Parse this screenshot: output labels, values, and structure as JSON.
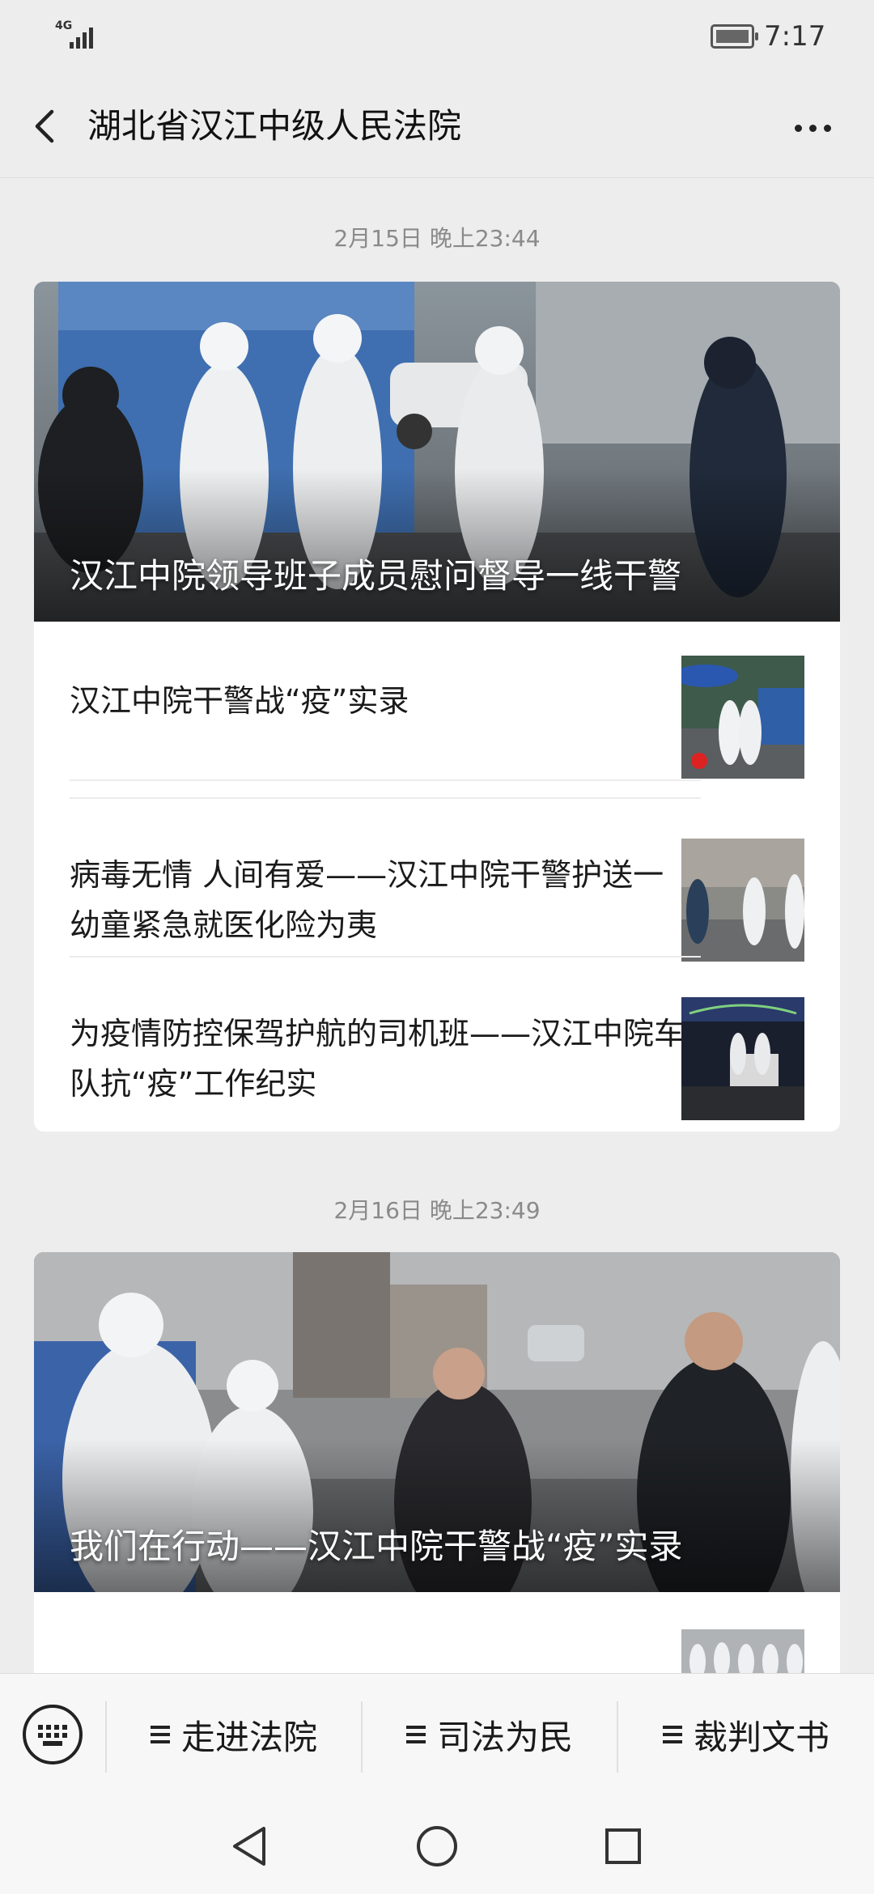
{
  "status_bar": {
    "network": "4G",
    "time": "7:17",
    "battery_icon": "battery-charging-icon",
    "signal_icon": "signal-bars-icon"
  },
  "nav": {
    "title": "湖北省汉江中级人民法院",
    "back_icon": "chevron-left-icon",
    "more_icon": "more-dots-icon"
  },
  "feed": [
    {
      "timestamp": "2月15日 晚上23:44",
      "cover_title": "汉江中院领导班子成员慰问督导一线干警",
      "items": [
        {
          "title": "汉江中院干警战“疫”实录"
        },
        {
          "title": "病毒无情 人间有爱——汉江中院干警护送一幼童紧急就医化险为夷"
        },
        {
          "title": "为疫情防控保驾护航的司机班——汉江中院车队抗“疫”工作纪实"
        }
      ]
    },
    {
      "timestamp": "2月16日 晚上23:49",
      "cover_title": "我们在行动——汉江中院干警战“疫”实录"
    }
  ],
  "bottom_menu": {
    "keyboard_icon": "keyboard-icon",
    "items": [
      {
        "label": "走进法院"
      },
      {
        "label": "司法为民"
      },
      {
        "label": "裁判文书"
      }
    ]
  },
  "system_nav": {
    "back_icon": "triangle-back-icon",
    "home_icon": "circle-home-icon",
    "recents_icon": "square-recents-icon"
  },
  "colors": {
    "background": "#ededed",
    "card": "#ffffff",
    "timestamp": "#8a8a8a",
    "text": "#1a1a1a"
  }
}
